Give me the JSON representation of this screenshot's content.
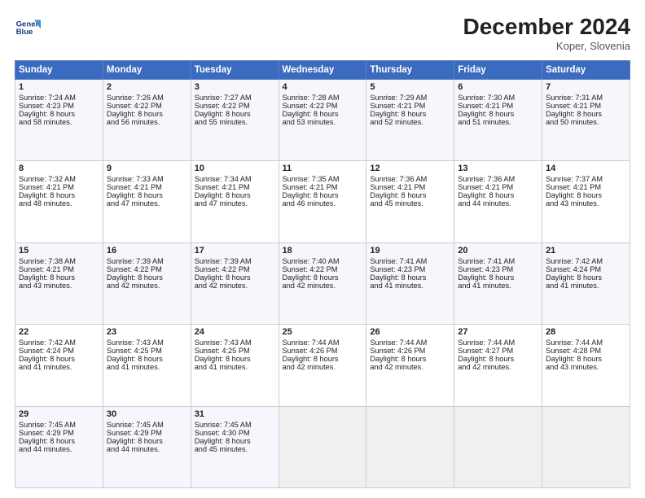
{
  "header": {
    "logo_line1": "General",
    "logo_line2": "Blue",
    "month": "December 2024",
    "location": "Koper, Slovenia"
  },
  "weekdays": [
    "Sunday",
    "Monday",
    "Tuesday",
    "Wednesday",
    "Thursday",
    "Friday",
    "Saturday"
  ],
  "weeks": [
    [
      {
        "day": "1",
        "lines": [
          "Sunrise: 7:24 AM",
          "Sunset: 4:23 PM",
          "Daylight: 8 hours",
          "and 58 minutes."
        ]
      },
      {
        "day": "2",
        "lines": [
          "Sunrise: 7:26 AM",
          "Sunset: 4:22 PM",
          "Daylight: 8 hours",
          "and 56 minutes."
        ]
      },
      {
        "day": "3",
        "lines": [
          "Sunrise: 7:27 AM",
          "Sunset: 4:22 PM",
          "Daylight: 8 hours",
          "and 55 minutes."
        ]
      },
      {
        "day": "4",
        "lines": [
          "Sunrise: 7:28 AM",
          "Sunset: 4:22 PM",
          "Daylight: 8 hours",
          "and 53 minutes."
        ]
      },
      {
        "day": "5",
        "lines": [
          "Sunrise: 7:29 AM",
          "Sunset: 4:21 PM",
          "Daylight: 8 hours",
          "and 52 minutes."
        ]
      },
      {
        "day": "6",
        "lines": [
          "Sunrise: 7:30 AM",
          "Sunset: 4:21 PM",
          "Daylight: 8 hours",
          "and 51 minutes."
        ]
      },
      {
        "day": "7",
        "lines": [
          "Sunrise: 7:31 AM",
          "Sunset: 4:21 PM",
          "Daylight: 8 hours",
          "and 50 minutes."
        ]
      }
    ],
    [
      {
        "day": "8",
        "lines": [
          "Sunrise: 7:32 AM",
          "Sunset: 4:21 PM",
          "Daylight: 8 hours",
          "and 48 minutes."
        ]
      },
      {
        "day": "9",
        "lines": [
          "Sunrise: 7:33 AM",
          "Sunset: 4:21 PM",
          "Daylight: 8 hours",
          "and 47 minutes."
        ]
      },
      {
        "day": "10",
        "lines": [
          "Sunrise: 7:34 AM",
          "Sunset: 4:21 PM",
          "Daylight: 8 hours",
          "and 47 minutes."
        ]
      },
      {
        "day": "11",
        "lines": [
          "Sunrise: 7:35 AM",
          "Sunset: 4:21 PM",
          "Daylight: 8 hours",
          "and 46 minutes."
        ]
      },
      {
        "day": "12",
        "lines": [
          "Sunrise: 7:36 AM",
          "Sunset: 4:21 PM",
          "Daylight: 8 hours",
          "and 45 minutes."
        ]
      },
      {
        "day": "13",
        "lines": [
          "Sunrise: 7:36 AM",
          "Sunset: 4:21 PM",
          "Daylight: 8 hours",
          "and 44 minutes."
        ]
      },
      {
        "day": "14",
        "lines": [
          "Sunrise: 7:37 AM",
          "Sunset: 4:21 PM",
          "Daylight: 8 hours",
          "and 43 minutes."
        ]
      }
    ],
    [
      {
        "day": "15",
        "lines": [
          "Sunrise: 7:38 AM",
          "Sunset: 4:21 PM",
          "Daylight: 8 hours",
          "and 43 minutes."
        ]
      },
      {
        "day": "16",
        "lines": [
          "Sunrise: 7:39 AM",
          "Sunset: 4:22 PM",
          "Daylight: 8 hours",
          "and 42 minutes."
        ]
      },
      {
        "day": "17",
        "lines": [
          "Sunrise: 7:39 AM",
          "Sunset: 4:22 PM",
          "Daylight: 8 hours",
          "and 42 minutes."
        ]
      },
      {
        "day": "18",
        "lines": [
          "Sunrise: 7:40 AM",
          "Sunset: 4:22 PM",
          "Daylight: 8 hours",
          "and 42 minutes."
        ]
      },
      {
        "day": "19",
        "lines": [
          "Sunrise: 7:41 AM",
          "Sunset: 4:23 PM",
          "Daylight: 8 hours",
          "and 41 minutes."
        ]
      },
      {
        "day": "20",
        "lines": [
          "Sunrise: 7:41 AM",
          "Sunset: 4:23 PM",
          "Daylight: 8 hours",
          "and 41 minutes."
        ]
      },
      {
        "day": "21",
        "lines": [
          "Sunrise: 7:42 AM",
          "Sunset: 4:24 PM",
          "Daylight: 8 hours",
          "and 41 minutes."
        ]
      }
    ],
    [
      {
        "day": "22",
        "lines": [
          "Sunrise: 7:42 AM",
          "Sunset: 4:24 PM",
          "Daylight: 8 hours",
          "and 41 minutes."
        ]
      },
      {
        "day": "23",
        "lines": [
          "Sunrise: 7:43 AM",
          "Sunset: 4:25 PM",
          "Daylight: 8 hours",
          "and 41 minutes."
        ]
      },
      {
        "day": "24",
        "lines": [
          "Sunrise: 7:43 AM",
          "Sunset: 4:25 PM",
          "Daylight: 8 hours",
          "and 41 minutes."
        ]
      },
      {
        "day": "25",
        "lines": [
          "Sunrise: 7:44 AM",
          "Sunset: 4:26 PM",
          "Daylight: 8 hours",
          "and 42 minutes."
        ]
      },
      {
        "day": "26",
        "lines": [
          "Sunrise: 7:44 AM",
          "Sunset: 4:26 PM",
          "Daylight: 8 hours",
          "and 42 minutes."
        ]
      },
      {
        "day": "27",
        "lines": [
          "Sunrise: 7:44 AM",
          "Sunset: 4:27 PM",
          "Daylight: 8 hours",
          "and 42 minutes."
        ]
      },
      {
        "day": "28",
        "lines": [
          "Sunrise: 7:44 AM",
          "Sunset: 4:28 PM",
          "Daylight: 8 hours",
          "and 43 minutes."
        ]
      }
    ],
    [
      {
        "day": "29",
        "lines": [
          "Sunrise: 7:45 AM",
          "Sunset: 4:29 PM",
          "Daylight: 8 hours",
          "and 44 minutes."
        ]
      },
      {
        "day": "30",
        "lines": [
          "Sunrise: 7:45 AM",
          "Sunset: 4:29 PM",
          "Daylight: 8 hours",
          "and 44 minutes."
        ]
      },
      {
        "day": "31",
        "lines": [
          "Sunrise: 7:45 AM",
          "Sunset: 4:30 PM",
          "Daylight: 8 hours",
          "and 45 minutes."
        ]
      },
      null,
      null,
      null,
      null
    ]
  ]
}
